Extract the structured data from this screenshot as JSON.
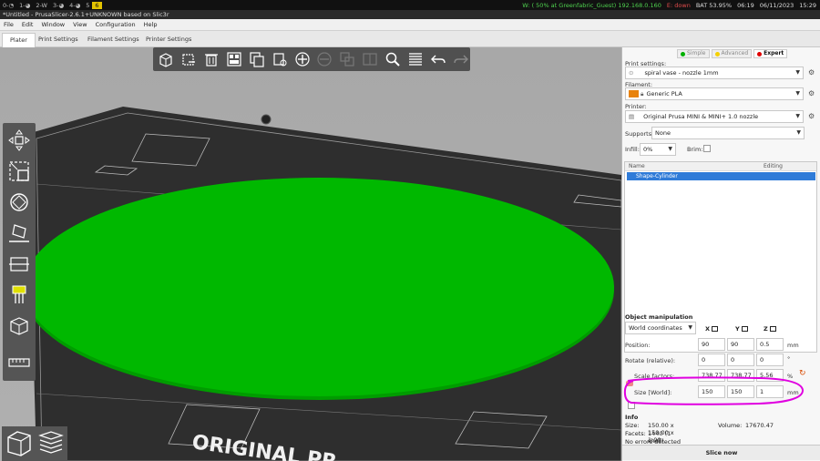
{
  "sysbar": {
    "workspaces": [
      "0-◔",
      "1-◕",
      "2-W",
      "3-◕",
      "4-◕",
      "5",
      "6"
    ],
    "active_workspace": "6",
    "wifi": "W: ( 50% at Greenfabric_Guest) 192.168.0.160",
    "eth": "E: down",
    "battery": "BAT 53.95%",
    "time_left": "06:19",
    "date": "06/11/2023",
    "clock": "15:29"
  },
  "window_title": "*Untitled - PrusaSlicer-2.6.1+UNKNOWN based on Slic3r",
  "menu": [
    "File",
    "Edit",
    "Window",
    "View",
    "Configuration",
    "Help"
  ],
  "tabs": [
    "Plater",
    "Print Settings",
    "Filament Settings",
    "Printer Settings"
  ],
  "toolbar_icons": [
    "add-icon",
    "delete-icon",
    "delete-all-icon",
    "arrange-icon",
    "copy-icon",
    "paste-icon",
    "add-instance-icon",
    "remove-instance-icon",
    "split-objects-icon",
    "split-parts-icon",
    "search-icon",
    "layers-icon",
    "undo-icon",
    "redo-icon"
  ],
  "left_tools": [
    "move-icon",
    "scale-icon",
    "rotate-icon",
    "place-on-face-icon",
    "cut-icon",
    "paint-supports-icon",
    "paint-seam-icon",
    "measure-icon"
  ],
  "bed_text": "ORIGINAL PR",
  "modes": {
    "simple": "Simple",
    "advanced": "Advanced",
    "expert": "Expert"
  },
  "mode_colors": {
    "simple": "#00b000",
    "advanced": "#f5d000",
    "expert": "#e00000"
  },
  "print_settings": {
    "label": "Print settings:",
    "value": "spiral vase - nozzle 1mm"
  },
  "filament": {
    "label": "Filament:",
    "value": "Generic PLA",
    "color": "#e8820c"
  },
  "printer": {
    "label": "Printer:",
    "value": "Original Prusa MINI & MINI+ 1.0 nozzle"
  },
  "supports": {
    "label": "Supports:",
    "value": "None"
  },
  "infill": {
    "label": "Infill:",
    "value": "0%"
  },
  "brim": {
    "label": "Brim:"
  },
  "object_list": {
    "col_name": "Name",
    "col_editing": "Editing",
    "rows": [
      "Shape-Cylinder"
    ]
  },
  "object_manipulation": {
    "title": "Object manipulation",
    "coords": "World coordinates",
    "axes": [
      "X",
      "Y",
      "Z"
    ],
    "position": {
      "label": "Position:",
      "values": [
        "90",
        "90",
        "0.5"
      ],
      "unit": "mm"
    },
    "rotate": {
      "label": "Rotate (relative):",
      "values": [
        "0",
        "0",
        "0"
      ],
      "unit": "°"
    },
    "scale": {
      "label": "Scale factors:",
      "values": [
        "738.77",
        "738.77",
        "5.56"
      ],
      "unit": "%"
    },
    "size": {
      "label": "Size [World]:",
      "values": [
        "150",
        "150",
        "1"
      ],
      "unit": "mm"
    }
  },
  "info": {
    "title": "Info",
    "size_label": "Size:",
    "size_value": "150.00 x 150.00 x 1.00",
    "volume_label": "Volume:",
    "volume_value": "17670.47",
    "facets_label": "Facets:",
    "facets_value": "1440 (1 shell)",
    "errors": "No errors detected"
  },
  "slice_button": "Slice now",
  "cylinder_color": "#00b800",
  "annotation_color": "#e000e0"
}
